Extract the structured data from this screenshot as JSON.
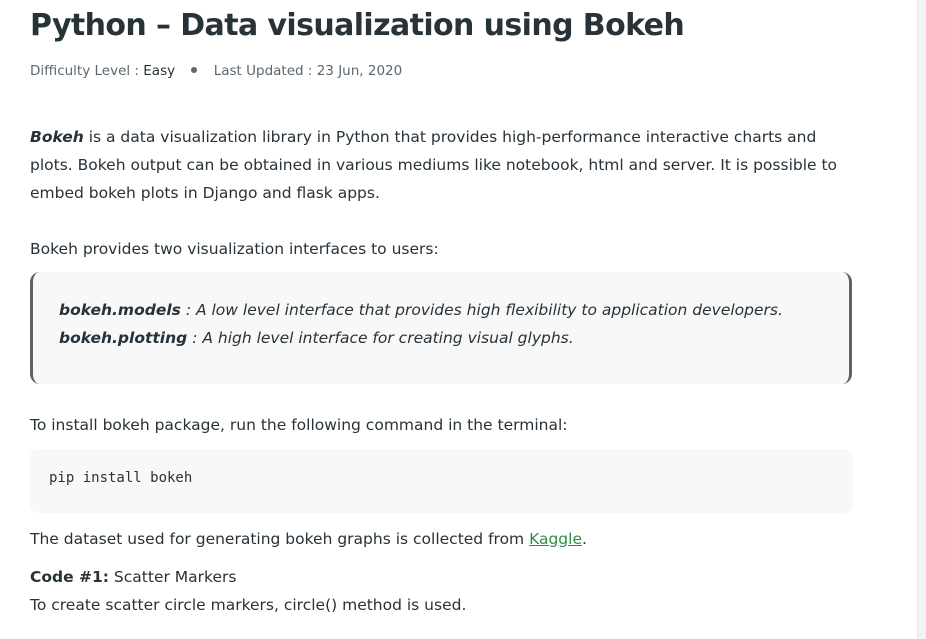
{
  "article": {
    "title": "Python – Data visualization using Bokeh",
    "meta": {
      "difficulty_label": "Difficulty Level :",
      "difficulty_value": "Easy",
      "updated_label": "Last Updated :",
      "updated_value": "23 Jun, 2020"
    },
    "intro": {
      "bold_word": "Bokeh",
      "text": " is a data visualization library in Python that provides high-performance interactive charts and plots. Bokeh output can be obtained in various mediums like notebook, html and server. It is possible to embed bokeh plots in Django and flask apps."
    },
    "interfaces_intro": "Bokeh provides two visualization interfaces to users:",
    "interfaces": [
      {
        "name": "bokeh.models",
        "desc": " : A low level interface that provides high flexibility to application developers."
      },
      {
        "name": "bokeh.plotting",
        "desc": " : A high level interface for creating visual glyphs."
      }
    ],
    "install_intro": "To install bokeh package, run the following command in the terminal:",
    "install_command": "pip install bokeh",
    "dataset": {
      "text": "The dataset used for generating bokeh graphs is collected from ",
      "link_label": "Kaggle",
      "suffix": "."
    },
    "code_heading": {
      "label": "Code #1:",
      "title": " Scatter Markers"
    },
    "code_desc": "To create scatter circle markers, circle() method is used."
  },
  "colors": {
    "text": "#273239",
    "link": "#2f8d46",
    "code_bg": "#f8f8f8",
    "quote_border": "#5f6368"
  }
}
